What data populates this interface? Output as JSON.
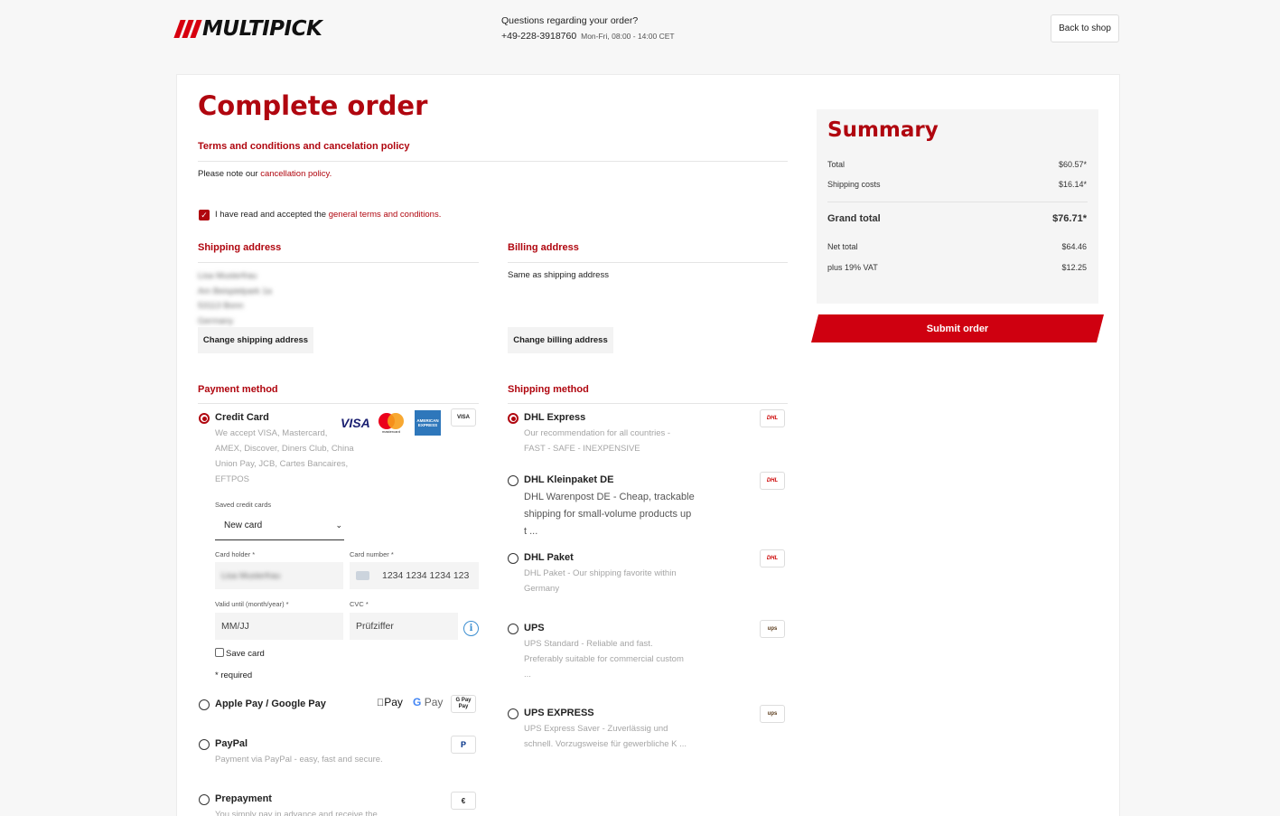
{
  "header": {
    "logo_text": "MULTIPICK",
    "contact_question": "Questions regarding your order?",
    "phone": "+49-228-3918760",
    "hours": "Mon-Fri, 08:00 - 14:00 CET",
    "back_label": "Back to shop"
  },
  "page_title": "Complete order",
  "terms": {
    "title": "Terms and conditions and cancelation policy",
    "note_prefix": "Please note our",
    "note_link": "cancellation policy.",
    "accept_prefix": "I have read and accepted the",
    "accept_link": "general terms and conditions.",
    "accepted": true
  },
  "shipping_address": {
    "title": "Shipping address",
    "lines": [
      "Lisa Musterfrau",
      "Am Beispielpark 1a",
      "53113 Bonn",
      "Germany"
    ],
    "button": "Change shipping address"
  },
  "billing_address": {
    "title": "Billing address",
    "text": "Same as shipping address",
    "button": "Change billing address"
  },
  "payment": {
    "title": "Payment method",
    "options": [
      {
        "label": "Credit Card",
        "selected": true,
        "desc": [
          "We accept VISA, Mastercard,",
          "AMEX, Discover, Diners Club, China",
          "Union Pay, JCB, Cartes Bancaires,",
          "EFTPOS"
        ]
      },
      {
        "label": "Apple Pay / Google Pay",
        "selected": false,
        "desc": []
      },
      {
        "label": "PayPal",
        "selected": false,
        "desc": [
          "Payment via PayPal - easy, fast and secure."
        ]
      },
      {
        "label": "Prepayment",
        "selected": false,
        "desc": [
          "You simply pay in advance and receive the"
        ]
      }
    ],
    "card_logos": {
      "visa": "VISA",
      "mastercard": "mastercard",
      "amex": "AMERICAN EXPRESS",
      "generic": "VISA"
    },
    "wallet_logos": {
      "apple": "Pay",
      "google": "Pay",
      "combo_top": "G Pay",
      "combo_bottom": "Pay"
    },
    "saved_cards_label": "Saved credit cards",
    "saved_cards_value": "New card",
    "card_holder_label": "Card holder *",
    "card_holder_value": "Lisa Musterfrau",
    "card_number_label": "Card number *",
    "card_number_placeholder": "1234 1234 1234 123",
    "valid_label": "Valid until (month/year) *",
    "valid_placeholder": "MM/JJ",
    "cvc_label": "CVC *",
    "cvc_placeholder": "Prüfziffer",
    "save_card_label": "Save card",
    "required_note": "* required"
  },
  "shipping": {
    "title": "Shipping method",
    "options": [
      {
        "label": "DHL Express",
        "selected": true,
        "desc": [
          "Our recommendation for all countries -",
          "FAST - SAFE - INEXPENSIVE"
        ],
        "logo": "DHL"
      },
      {
        "label": "DHL Kleinpaket DE",
        "selected": false,
        "desc": [
          "DHL Warenpost DE - Cheap, trackable",
          "shipping for small-volume products up",
          "t ..."
        ],
        "logo": "DHL"
      },
      {
        "label": "DHL Paket",
        "selected": false,
        "desc": [
          "DHL Paket - Our shipping favorite within",
          "Germany"
        ],
        "logo": "DHL"
      },
      {
        "label": "UPS",
        "selected": false,
        "desc": [
          "UPS Standard - Reliable and fast.",
          "Preferably suitable for commercial custom",
          "..."
        ],
        "logo": "ups"
      },
      {
        "label": "UPS EXPRESS",
        "selected": false,
        "desc": [
          "UPS Express Saver - Zuverlässig und",
          "schnell. Vorzugsweise für gewerbliche K ..."
        ],
        "logo": "ups"
      }
    ]
  },
  "summary": {
    "title": "Summary",
    "total_label": "Total",
    "total_value": "$60.57*",
    "shipping_label": "Shipping costs",
    "shipping_value": "$16.14*",
    "grand_label": "Grand total",
    "grand_value": "$76.71*",
    "net_label": "Net total",
    "net_value": "$64.46",
    "vat_label": "plus 19% VAT",
    "vat_value": "$12.25",
    "submit_label": "Submit order"
  },
  "colors": {
    "accent": "#b0060f",
    "button_red": "#cf0010",
    "info_blue": "#3b8ed1"
  }
}
